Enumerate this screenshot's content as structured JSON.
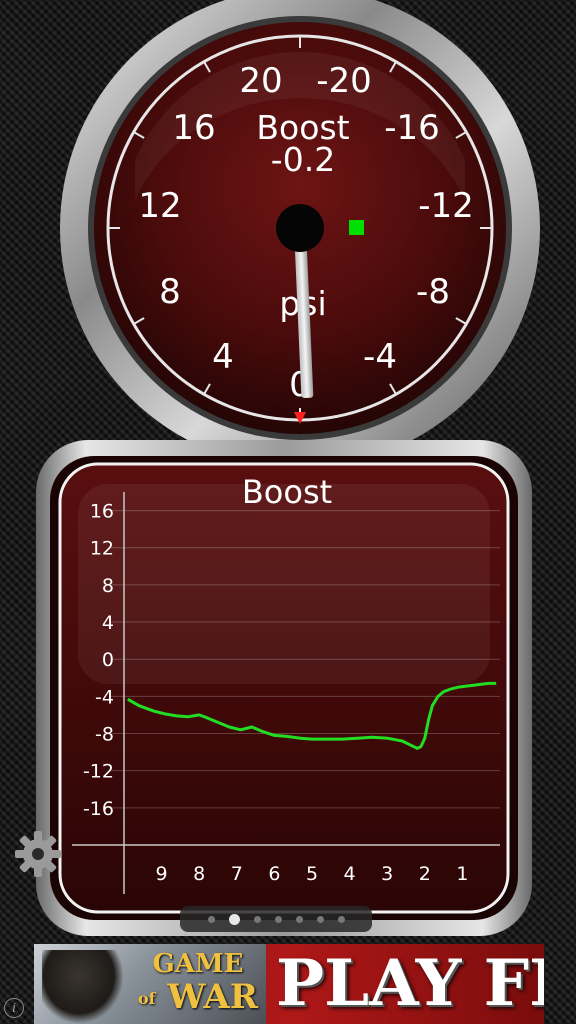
{
  "gauge": {
    "title": "Boost",
    "value": "-0.2",
    "unit": "psi",
    "needle_value": -0.2,
    "indicator_color": "#00e000",
    "marker_color": "#ff2020",
    "ticks_left": [
      "20",
      "16",
      "12",
      "8",
      "4"
    ],
    "tick_zero": "0",
    "ticks_right": [
      "-20",
      "-16",
      "-12",
      "-8",
      "-4"
    ]
  },
  "graph": {
    "title": "Boost",
    "y_ticks": [
      "16",
      "12",
      "8",
      "4",
      "0",
      "-4",
      "-8",
      "-12",
      "-16"
    ],
    "x_ticks": [
      "9",
      "8",
      "7",
      "6",
      "5",
      "4",
      "3",
      "2",
      "1"
    ],
    "line_color": "#22dd22"
  },
  "chart_data": {
    "type": "line",
    "title": "Boost",
    "xlabel": "",
    "ylabel": "",
    "ylim": [
      -20,
      18
    ],
    "x_range": [
      10,
      0
    ],
    "grid": true,
    "series": [
      {
        "x": [
          9.9,
          9.6,
          9.2,
          8.9,
          8.6,
          8.3,
          8.0,
          7.8,
          7.5,
          7.2,
          6.9,
          6.6,
          6.3,
          6.0,
          5.7,
          5.3,
          5.0,
          4.6,
          4.2,
          3.8,
          3.4,
          3.0,
          2.6,
          2.4,
          2.2,
          2.1,
          2.0,
          1.9,
          1.8,
          1.65,
          1.5,
          1.3,
          1.1,
          0.9,
          0.7,
          0.5,
          0.3,
          0.1
        ],
        "y": [
          -4.3,
          -5.0,
          -5.6,
          -5.9,
          -6.1,
          -6.2,
          -6.0,
          -6.3,
          -6.8,
          -7.3,
          -7.6,
          -7.3,
          -7.8,
          -8.2,
          -8.3,
          -8.5,
          -8.6,
          -8.6,
          -8.6,
          -8.5,
          -8.4,
          -8.5,
          -8.8,
          -9.2,
          -9.6,
          -9.4,
          -8.5,
          -6.5,
          -5.0,
          -4.0,
          -3.5,
          -3.2,
          -3.0,
          -2.9,
          -2.8,
          -2.7,
          -2.6,
          -2.6
        ]
      }
    ]
  }
}
